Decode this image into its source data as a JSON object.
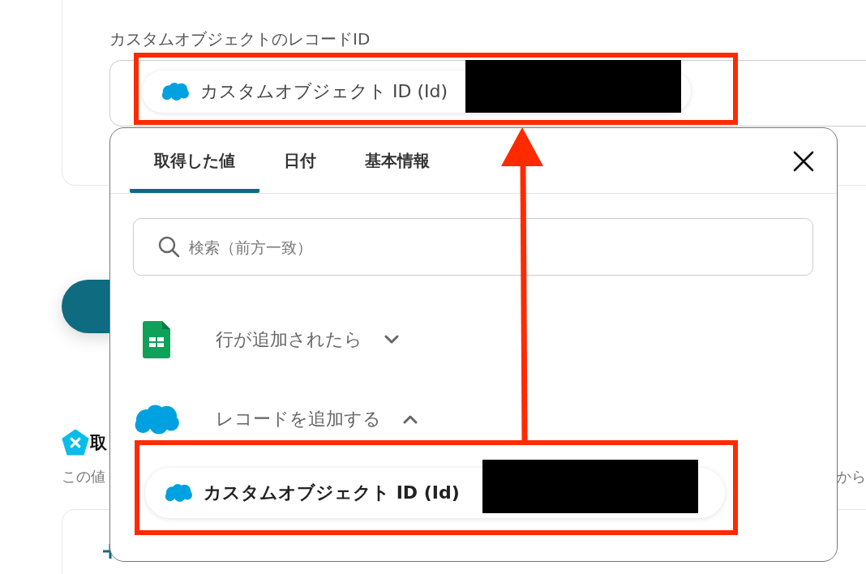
{
  "record_field": {
    "label": "カスタムオブジェクトのレコードID",
    "chip": {
      "text": "カスタムオブジェクト ID (Id)",
      "kind": "salesforce"
    }
  },
  "section": {
    "heading": "取",
    "description_start": "この値",
    "description_end": "から"
  },
  "popup": {
    "tabs": [
      {
        "label": "取得した値",
        "selected": true
      },
      {
        "label": "日付",
        "selected": false
      },
      {
        "label": "基本情報",
        "selected": false
      }
    ],
    "search": {
      "placeholder": "検索（前方一致）"
    },
    "groups": [
      {
        "label": "行が追加されたら",
        "kind": "sheets",
        "expanded": false
      },
      {
        "label": "レコードを追加する",
        "kind": "salesforce",
        "expanded": true,
        "items": [
          {
            "text": "カスタムオブジェクト ID (Id)",
            "kind": "salesforce"
          }
        ]
      }
    ]
  }
}
